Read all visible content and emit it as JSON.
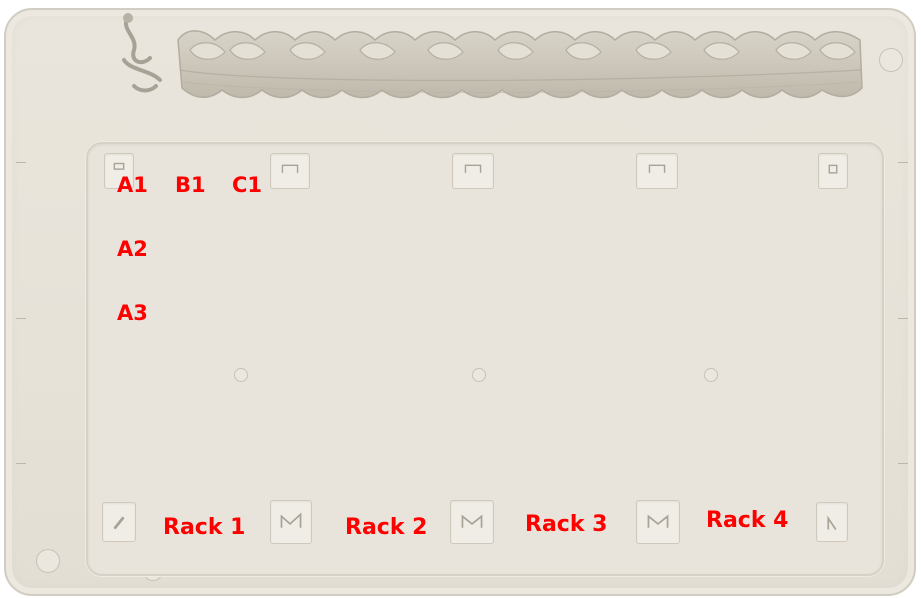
{
  "labels": {
    "wells": [
      "A1",
      "B1",
      "C1",
      "A2",
      "A3"
    ],
    "racks": [
      "Rack 1",
      "Rack 2",
      "Rack 3",
      "Rack 4"
    ]
  },
  "colors": {
    "label": "#ff0000",
    "tray": "#e6e2d8",
    "tray_edge": "#d2cdc2"
  },
  "icons": {
    "top_left_clip": "wire-clip-icon",
    "tube_holder": "tube-holder-ridge"
  }
}
